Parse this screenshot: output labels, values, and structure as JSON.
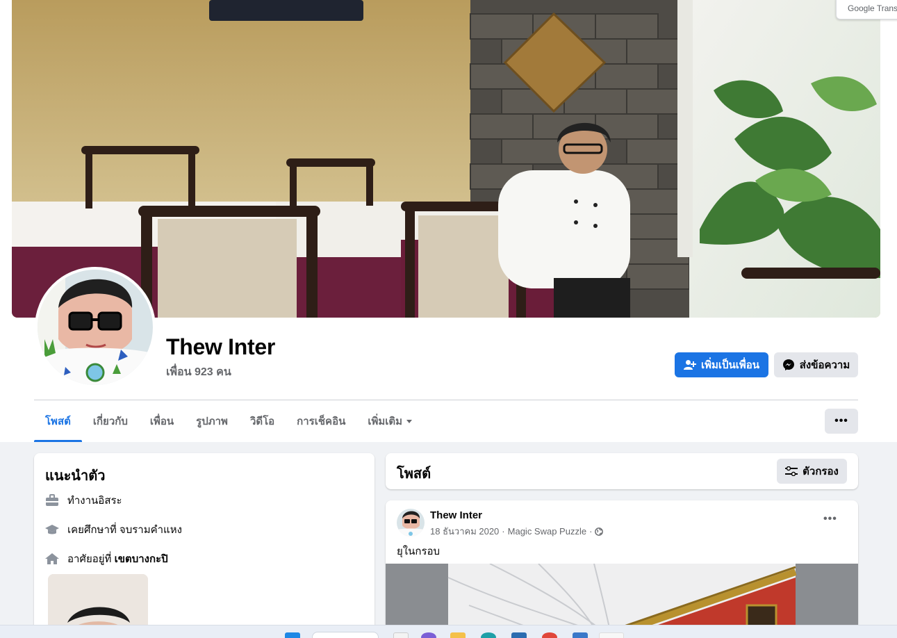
{
  "browser": {
    "translate_tab_label": "Google Trans"
  },
  "profile": {
    "name": "Thew Inter",
    "friends_count": "เพื่อน 923 คน",
    "add_friend_label": "เพิ่มเป็นเพื่อน",
    "message_label": "ส่งข้อความ"
  },
  "tabs": [
    {
      "label": "โพสต์",
      "active": true
    },
    {
      "label": "เกี่ยวกับ",
      "active": false
    },
    {
      "label": "เพื่อน",
      "active": false
    },
    {
      "label": "รูปภาพ",
      "active": false
    },
    {
      "label": "วิดีโอ",
      "active": false
    },
    {
      "label": "การเช็คอิน",
      "active": false
    },
    {
      "label": "เพิ่มเติม",
      "active": false
    }
  ],
  "intro": {
    "title": "แนะนำตัว",
    "work": "ทำงานอิสระ",
    "education": "เคยศึกษาที่ จบรามคำแหง",
    "lives_prefix": "อาศัยอยู่ที่ ",
    "lives_place": "เขตบางกะปิ"
  },
  "posts": {
    "title": "โพสต์",
    "filter_label": "ตัวกรอง",
    "items": [
      {
        "author": "Thew Inter",
        "date": "18 ธันวาคม 2020",
        "app": "Magic Swap Puzzle",
        "privacy_icon": "globe-icon",
        "text": "ยุในกรอบ"
      }
    ]
  },
  "colors": {
    "accent": "#1b74e4",
    "background": "#f0f2f5",
    "secondary_button": "#e4e6eb",
    "muted_text": "#65676b"
  }
}
